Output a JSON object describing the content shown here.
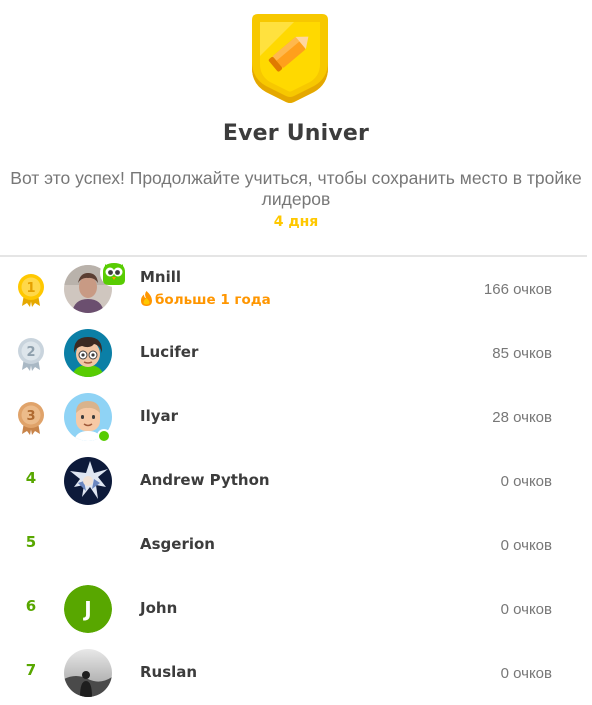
{
  "league": {
    "title": "Ever Univer",
    "message": "Вот это успех! Продолжайте учиться, чтобы сохранить место в тройке лидеров",
    "days_left": "4 дня",
    "badge_color": "#ffc800"
  },
  "leaderboard": [
    {
      "rank": "1",
      "name": "Mnill",
      "streak": "больше 1 года",
      "xp": "166 очков",
      "medal": "gold"
    },
    {
      "rank": "2",
      "name": "Lucifer",
      "xp": "85 очков",
      "medal": "silver"
    },
    {
      "rank": "3",
      "name": "Ilyar",
      "xp": "28 очков",
      "medal": "bronze"
    },
    {
      "rank": "4",
      "name": "Andrew Python",
      "xp": "0 очков"
    },
    {
      "rank": "5",
      "name": "Asgerion",
      "xp": "0 очков"
    },
    {
      "rank": "6",
      "name": "John",
      "avatar_letter": "J",
      "xp": "0 очков"
    },
    {
      "rank": "7",
      "name": "Ruslan",
      "xp": "0 очков"
    }
  ],
  "colors": {
    "rank_green": "#58a700",
    "streak_orange": "#ff9600",
    "gold": "#ffc800",
    "silver": "#c9d4dd",
    "bronze": "#e0a36a"
  }
}
